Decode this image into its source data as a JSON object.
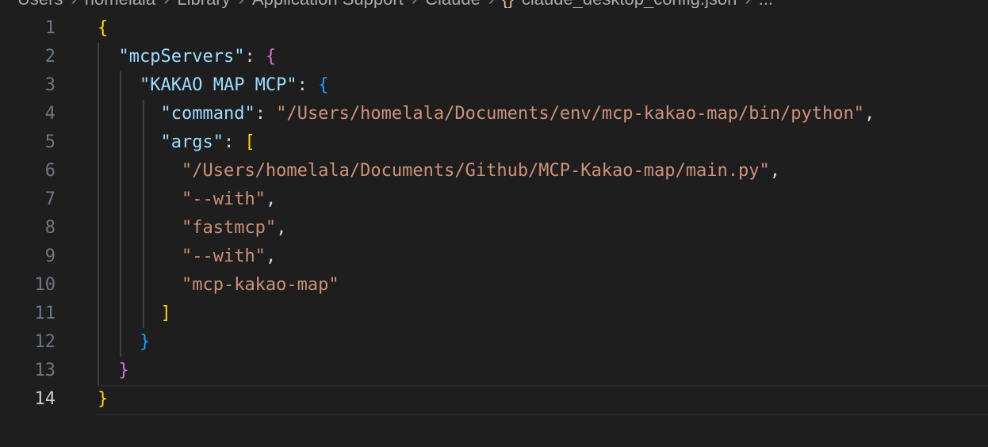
{
  "breadcrumb": {
    "items": [
      "Users",
      "homelala",
      "Library",
      "Application Support",
      "Claude"
    ],
    "file_icon": "{}",
    "file": "claude_desktop_config.json",
    "more": "..."
  },
  "editor": {
    "current_line": 14,
    "lines": [
      {
        "number": "1",
        "tokens": [
          {
            "text": "{",
            "type": "b1"
          }
        ]
      },
      {
        "number": "2",
        "tokens": [
          {
            "text": "  "
          },
          {
            "text": "\"mcpServers\"",
            "type": "key"
          },
          {
            "text": ": ",
            "type": "punc"
          },
          {
            "text": "{",
            "type": "b2"
          }
        ]
      },
      {
        "number": "3",
        "tokens": [
          {
            "text": "    "
          },
          {
            "text": "\"KAKAO MAP MCP\"",
            "type": "key"
          },
          {
            "text": ": ",
            "type": "punc"
          },
          {
            "text": "{",
            "type": "b3"
          }
        ]
      },
      {
        "number": "4",
        "tokens": [
          {
            "text": "      "
          },
          {
            "text": "\"command\"",
            "type": "key"
          },
          {
            "text": ": ",
            "type": "punc"
          },
          {
            "text": "\"/Users/homelala/Documents/env/mcp-kakao-map/bin/python\"",
            "type": "str"
          },
          {
            "text": ",",
            "type": "punc"
          }
        ]
      },
      {
        "number": "5",
        "tokens": [
          {
            "text": "      "
          },
          {
            "text": "\"args\"",
            "type": "key"
          },
          {
            "text": ": ",
            "type": "punc"
          },
          {
            "text": "[",
            "type": "b1"
          }
        ]
      },
      {
        "number": "6",
        "tokens": [
          {
            "text": "        "
          },
          {
            "text": "\"/Users/homelala/Documents/Github/MCP-Kakao-map/main.py\"",
            "type": "str"
          },
          {
            "text": ",",
            "type": "punc"
          }
        ]
      },
      {
        "number": "7",
        "tokens": [
          {
            "text": "        "
          },
          {
            "text": "\"--with\"",
            "type": "str"
          },
          {
            "text": ",",
            "type": "punc"
          }
        ]
      },
      {
        "number": "8",
        "tokens": [
          {
            "text": "        "
          },
          {
            "text": "\"fastmcp\"",
            "type": "str"
          },
          {
            "text": ",",
            "type": "punc"
          }
        ]
      },
      {
        "number": "9",
        "tokens": [
          {
            "text": "        "
          },
          {
            "text": "\"--with\"",
            "type": "str"
          },
          {
            "text": ",",
            "type": "punc"
          }
        ]
      },
      {
        "number": "10",
        "tokens": [
          {
            "text": "        "
          },
          {
            "text": "\"mcp-kakao-map\"",
            "type": "str"
          }
        ]
      },
      {
        "number": "11",
        "tokens": [
          {
            "text": "      "
          },
          {
            "text": "]",
            "type": "b1"
          }
        ]
      },
      {
        "number": "12",
        "tokens": [
          {
            "text": "    "
          },
          {
            "text": "}",
            "type": "b3"
          }
        ]
      },
      {
        "number": "13",
        "tokens": [
          {
            "text": "  "
          },
          {
            "text": "}",
            "type": "b2"
          }
        ]
      },
      {
        "number": "14",
        "tokens": [
          {
            "text": "}",
            "type": "b1"
          }
        ]
      }
    ]
  },
  "colors": {
    "background": "#1e1e1e",
    "key": "#9cdcfe",
    "string": "#ce9178",
    "bracket_gold": "#ffd700",
    "bracket_orchid": "#da70d6",
    "bracket_blue": "#179fff",
    "line_number": "#6e7681"
  }
}
